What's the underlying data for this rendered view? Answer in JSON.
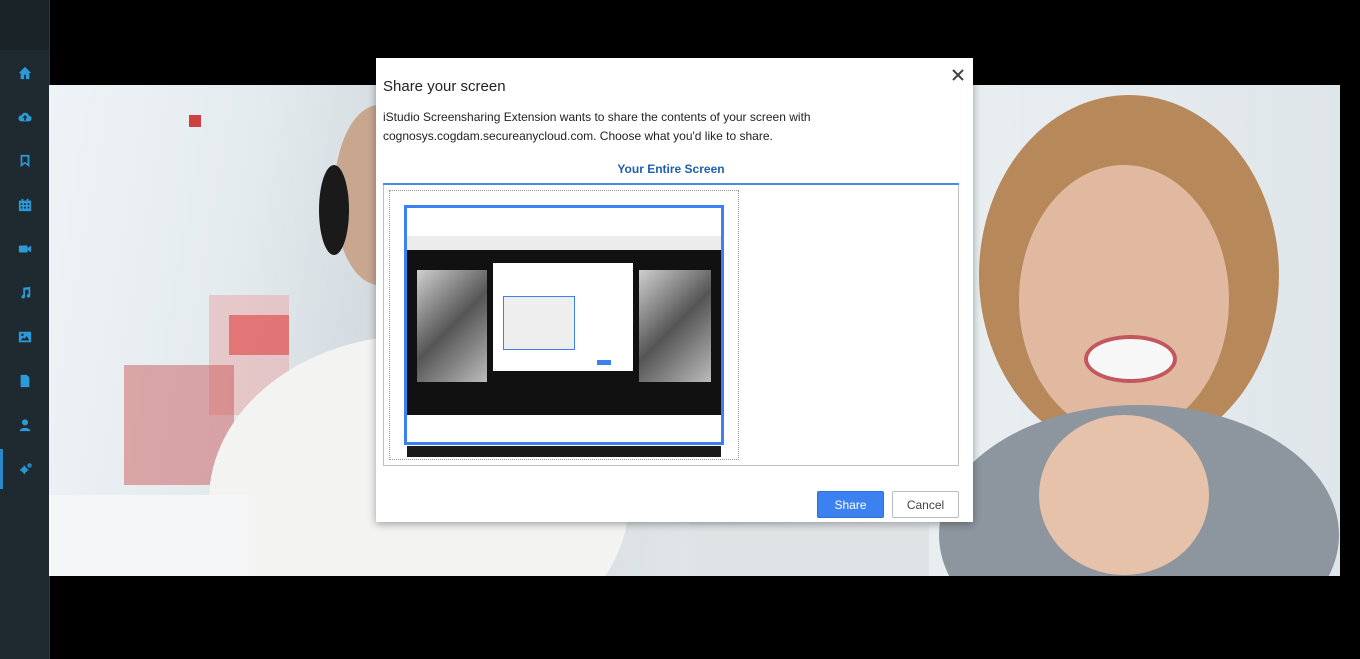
{
  "sidebar": {
    "items": [
      {
        "icon": "home-icon"
      },
      {
        "icon": "cloud-upload-icon"
      },
      {
        "icon": "bookmark-icon"
      },
      {
        "icon": "calendar-icon"
      },
      {
        "icon": "video-camera-icon"
      },
      {
        "icon": "music-icon"
      },
      {
        "icon": "image-icon"
      },
      {
        "icon": "file-icon"
      },
      {
        "icon": "user-icon"
      },
      {
        "icon": "settings-gears-icon",
        "active": true
      }
    ],
    "accent": "#2b9ad8"
  },
  "dialog": {
    "title": "Share your screen",
    "description": "iStudio Screensharing Extension wants to share the contents of your screen with cognosys.cogdam.secureanycloud.com. Choose what you'd like to share.",
    "tab_label": "Your Entire Screen",
    "share_label": "Share",
    "cancel_label": "Cancel",
    "close_glyph": "✕"
  },
  "colors": {
    "primary_button": "#3b82f0",
    "tab_text": "#2060b0"
  }
}
